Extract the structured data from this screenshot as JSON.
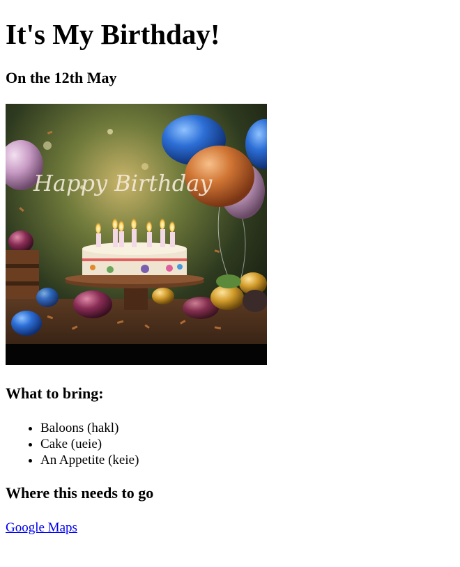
{
  "header": {
    "title": "It's My Birthday!",
    "subtitle": "On the 12th May"
  },
  "hero_image": {
    "text": "Happy Birthday",
    "description_icon": "birthday-cake-image"
  },
  "bring": {
    "heading": "What to bring:",
    "items": [
      "Baloons (hakl)",
      "Cake (ueie)",
      "An Appetite (keie)"
    ]
  },
  "where": {
    "heading": "Where this needs to go",
    "link_label": "Google Maps"
  },
  "colors": {
    "link": "#0000ee",
    "text": "#000000",
    "background": "#ffffff"
  }
}
